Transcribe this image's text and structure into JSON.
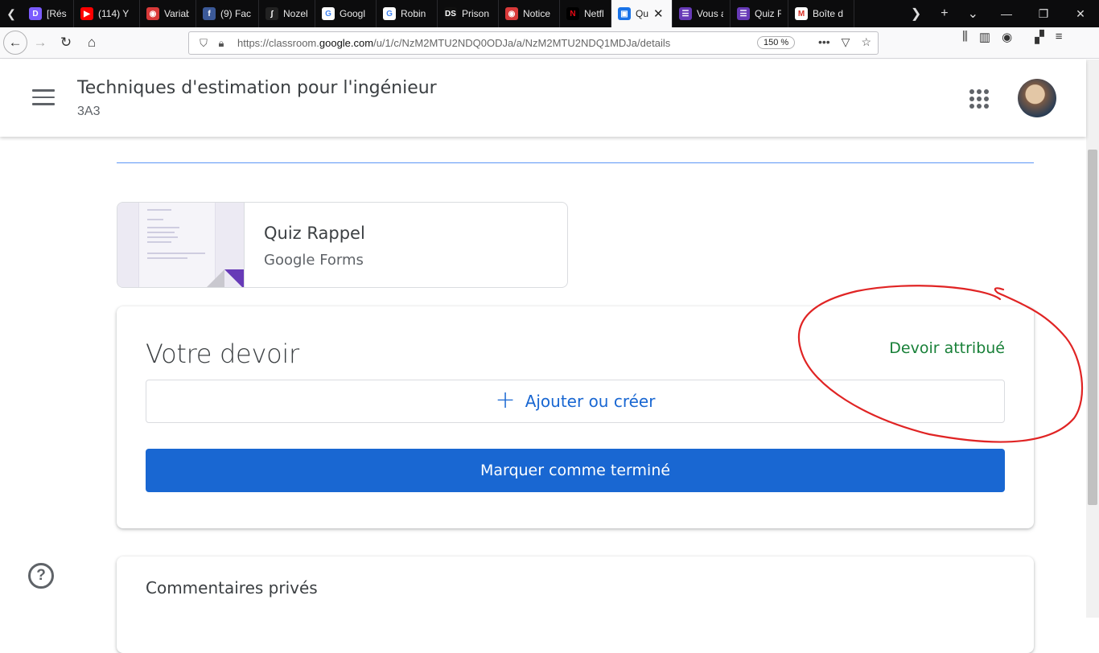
{
  "browser": {
    "tabs": [
      {
        "label": "[Résol",
        "icon": "tab-favicon",
        "color": "#7b5cff",
        "glyph": "D"
      },
      {
        "label": "(114) Y",
        "icon": "youtube-icon",
        "color": "#ff0000",
        "glyph": "▶"
      },
      {
        "label": "Variabl",
        "icon": "tab-favicon",
        "color": "#d93a3a",
        "glyph": "◉"
      },
      {
        "label": "(9) Fac",
        "icon": "facebook-icon",
        "color": "#3b5998",
        "glyph": "f"
      },
      {
        "label": "Nozeli",
        "icon": "tab-favicon",
        "color": "#222222",
        "glyph": "∫"
      },
      {
        "label": "Googl",
        "icon": "google-icon",
        "color": "#ffffff",
        "glyph": "G"
      },
      {
        "label": "Robin",
        "icon": "google-icon",
        "color": "#ffffff",
        "glyph": "G"
      },
      {
        "label": "Prison",
        "icon": "tab-favicon",
        "color": "#111111",
        "glyph": "DS"
      },
      {
        "label": "Notice",
        "icon": "tab-favicon",
        "color": "#d93a3a",
        "glyph": "◉"
      },
      {
        "label": "Netflix",
        "icon": "netflix-icon",
        "color": "#000000",
        "glyph": "N"
      },
      {
        "label": "Qu",
        "icon": "classroom-icon",
        "color": "#1a73e8",
        "glyph": "▣",
        "active": true
      },
      {
        "label": "Vous a",
        "icon": "forms-icon",
        "color": "#673ab7",
        "glyph": "☰"
      },
      {
        "label": "Quiz R",
        "icon": "forms-icon",
        "color": "#673ab7",
        "glyph": "☰"
      },
      {
        "label": "Boîte d",
        "icon": "gmail-icon",
        "color": "#ffffff",
        "glyph": "M"
      }
    ],
    "url_prefix": "https://classroom.",
    "url_domain": "google.com",
    "url_path": "/u/1/c/NzM2MTU2NDQ0ODJa/a/NzM2MTU2NDQ1MDJa/details",
    "zoom": "150 %"
  },
  "header": {
    "class_title": "Techniques d'estimation pour l'ingénieur",
    "class_section": "3A3"
  },
  "attachment": {
    "title": "Quiz Rappel",
    "type": "Google Forms"
  },
  "work": {
    "title": "Votre devoir",
    "status": "Devoir attribué",
    "add_label": "Ajouter ou créer",
    "done_label": "Marquer comme terminé"
  },
  "comments": {
    "title": "Commentaires privés"
  },
  "colors": {
    "status_green": "#188038",
    "primary_blue": "#1967d2",
    "annotation_red": "#e02424",
    "forms_purple": "#673ab7"
  }
}
